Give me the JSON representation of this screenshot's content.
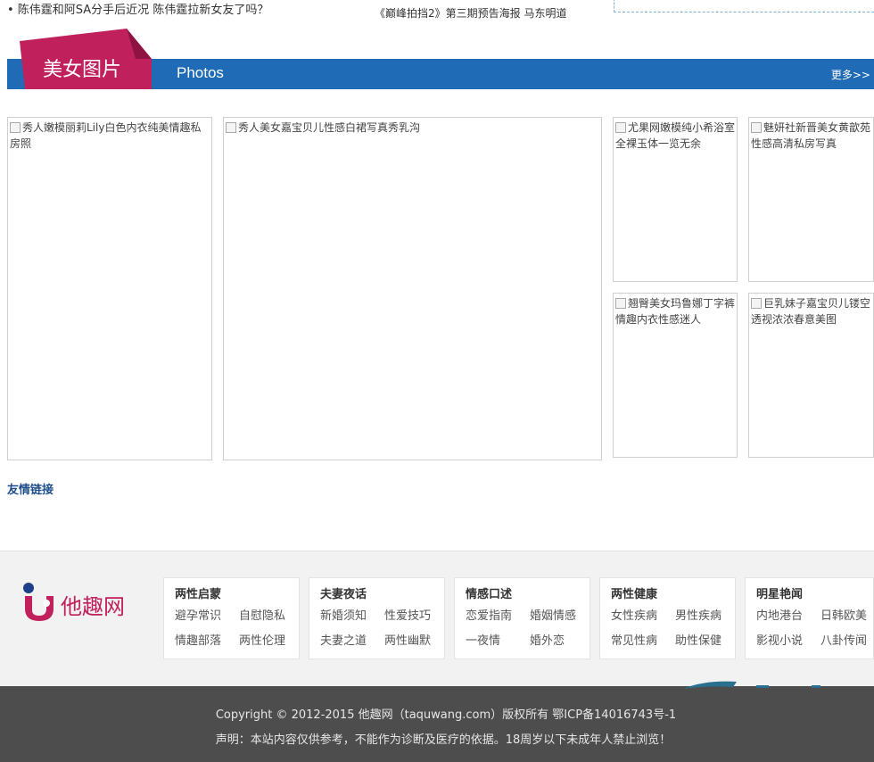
{
  "top_news": {
    "left": "• 陈伟霆和阿SA分手后近况 陈伟霆拉新女友了吗？",
    "right": "《巅峰拍挡2》第三期预告海报 马东明道"
  },
  "section": {
    "title": "美女图片",
    "subtitle": "Photos",
    "more": "更多>>"
  },
  "photos": [
    {
      "alt": "秀人嫩模丽莉Lily白色内衣纯美情趣私房照"
    },
    {
      "alt": "秀人美女嘉宝贝儿性感白裙写真秀乳沟"
    },
    {
      "alt": "尤果网嫩模纯小希浴室全裸玉体一览无余"
    },
    {
      "alt": "魅妍社新晋美女黄歆苑性感高清私房写真"
    },
    {
      "alt": "翘臀美女玛鲁娜丁字裤情趣内衣性感迷人"
    },
    {
      "alt": "巨乳妹子嘉宝贝儿镂空透视浓浓春意美图"
    }
  ],
  "friend_links": {
    "title": "友情链接"
  },
  "footer": {
    "logo_text": "他趣网",
    "categories": [
      {
        "title": "两性启蒙",
        "links": [
          "避孕常识",
          "自慰隐私",
          "情趣部落",
          "两性伦理"
        ]
      },
      {
        "title": "夫妻夜话",
        "links": [
          "新婚须知",
          "性爱技巧",
          "夫妻之道",
          "两性幽默"
        ]
      },
      {
        "title": "情感口述",
        "links": [
          "恋爱指南",
          "婚姻情感",
          "一夜情",
          "婚外恋"
        ]
      },
      {
        "title": "两性健康",
        "links": [
          "女性疾病",
          "男性疾病",
          "常见性病",
          "助性保健"
        ]
      },
      {
        "title": "明星艳闻",
        "links": [
          "内地港台",
          "日韩欧美",
          "影视小说",
          "八卦传闻"
        ]
      }
    ],
    "copyright": "Copyright © 2012-2015 他趣网（taquwang.com）版权所有 鄂ICP备14016743号-1",
    "notice": "声明：本站内容仅供参考，不能作为诊断及医疗的依据。18周岁以下未成年人禁止浏览！"
  },
  "colors": {
    "accent_blue": "#1f6bb5",
    "tab_red": "#c0205c",
    "footer_dark": "#4d4d4d"
  }
}
